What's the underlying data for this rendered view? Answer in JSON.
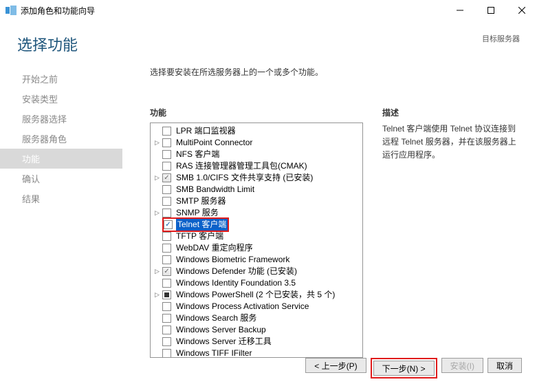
{
  "window": {
    "title": "添加角色和功能向导"
  },
  "header": {
    "title": "选择功能",
    "destination_label": "目标服务器"
  },
  "sidebar": {
    "items": [
      {
        "label": "开始之前"
      },
      {
        "label": "安装类型"
      },
      {
        "label": "服务器选择"
      },
      {
        "label": "服务器角色"
      },
      {
        "label": "功能",
        "active": true
      },
      {
        "label": "确认"
      },
      {
        "label": "结果"
      }
    ]
  },
  "content": {
    "intro": "选择要安装在所选服务器上的一个或多个功能。",
    "features_label": "功能",
    "description_label": "描述",
    "description_text": "Telnet 客户端使用 Telnet 协议连接到远程 Telnet 服务器，并在该服务器上运行应用程序。",
    "features": [
      {
        "expand": "none",
        "state": "unchecked",
        "label": "LPR 端口监视器"
      },
      {
        "expand": "collapsed",
        "state": "unchecked",
        "label": "MultiPoint Connector"
      },
      {
        "expand": "none",
        "state": "unchecked",
        "label": "NFS 客户端"
      },
      {
        "expand": "none",
        "state": "unchecked",
        "label": "RAS 连接管理器管理工具包(CMAK)"
      },
      {
        "expand": "collapsed",
        "state": "checked-gray",
        "label": "SMB 1.0/CIFS 文件共享支持 (已安装)"
      },
      {
        "expand": "none",
        "state": "unchecked",
        "label": "SMB Bandwidth Limit"
      },
      {
        "expand": "none",
        "state": "unchecked",
        "label": "SMTP 服务器"
      },
      {
        "expand": "collapsed",
        "state": "unchecked",
        "label": "SNMP 服务"
      },
      {
        "expand": "none",
        "state": "checked-blue",
        "label": "Telnet 客户端",
        "selected": true,
        "highlighted": true
      },
      {
        "expand": "none",
        "state": "unchecked",
        "label": "TFTP 客户端"
      },
      {
        "expand": "none",
        "state": "unchecked",
        "label": "WebDAV 重定向程序"
      },
      {
        "expand": "none",
        "state": "unchecked",
        "label": "Windows Biometric Framework"
      },
      {
        "expand": "collapsed",
        "state": "checked-gray",
        "label": "Windows Defender 功能 (已安装)"
      },
      {
        "expand": "none",
        "state": "unchecked",
        "label": "Windows Identity Foundation 3.5"
      },
      {
        "expand": "collapsed",
        "state": "filled",
        "label": "Windows PowerShell (2 个已安装，共 5 个)"
      },
      {
        "expand": "none",
        "state": "unchecked",
        "label": "Windows Process Activation Service"
      },
      {
        "expand": "none",
        "state": "unchecked",
        "label": "Windows Search 服务"
      },
      {
        "expand": "none",
        "state": "unchecked",
        "label": "Windows Server Backup"
      },
      {
        "expand": "none",
        "state": "unchecked",
        "label": "Windows Server 迁移工具"
      },
      {
        "expand": "none",
        "state": "unchecked",
        "label": "Windows TIFF IFilter"
      }
    ]
  },
  "footer": {
    "prev": "< 上一步(P)",
    "next": "下一步(N) >",
    "install": "安装(I)",
    "cancel": "取消"
  }
}
